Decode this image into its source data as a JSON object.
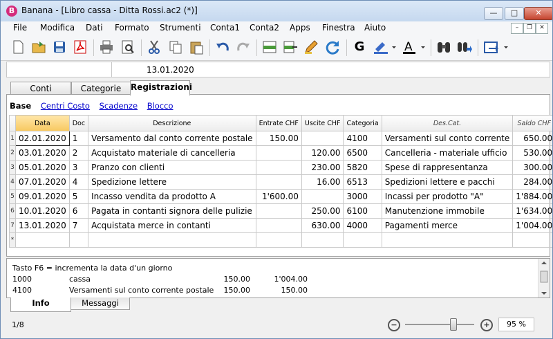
{
  "window": {
    "title": "Banana - [Libro cassa - Ditta Rossi.ac2 (*)]",
    "app_icon": "B"
  },
  "window_buttons": {
    "minimize": "—",
    "maximize": "□",
    "close": "✕"
  },
  "menubar": [
    "File",
    "Modifica",
    "Dati",
    "Formato",
    "Strumenti",
    "Conta1",
    "Conta2",
    "Apps",
    "Finestra",
    "Aiuto"
  ],
  "mdi_buttons": {
    "minimize": "–",
    "restore": "❐",
    "close": "✕"
  },
  "address_bar": {
    "cell_value": "13.01.2020"
  },
  "tabs": [
    "Conti",
    "Categorie",
    "Registrazioni"
  ],
  "active_tab": "Registrazioni",
  "views": {
    "active": "Base",
    "links": [
      "Centri Costo",
      "Scadenze",
      "Blocco"
    ]
  },
  "table": {
    "columns": [
      "Data",
      "Doc",
      "Descrizione",
      "Entrate CHF",
      "Uscite CHF",
      "Categoria",
      "Des.Cat.",
      "Saldo CHF"
    ],
    "rows": [
      {
        "n": "1",
        "date": "02.01.2020",
        "doc": "1",
        "desc": "Versamento dal conto corrente postale",
        "in": "150.00",
        "out": "",
        "cat": "4100",
        "descat": "Versamenti sul conto corrente",
        "saldo": "650.00"
      },
      {
        "n": "2",
        "date": "03.01.2020",
        "doc": "2",
        "desc": "Acquistato materiale di cancelleria",
        "in": "",
        "out": "120.00",
        "cat": "6500",
        "descat": "Cancelleria - materiale ufficio",
        "saldo": "530.00"
      },
      {
        "n": "3",
        "date": "05.01.2020",
        "doc": "3",
        "desc": "Pranzo con clienti",
        "in": "",
        "out": "230.00",
        "cat": "5820",
        "descat": "Spese di rappresentanza",
        "saldo": "300.00"
      },
      {
        "n": "4",
        "date": "07.01.2020",
        "doc": "4",
        "desc": "Spedizione lettere",
        "in": "",
        "out": "16.00",
        "cat": "6513",
        "descat": "Spedizioni lettere e pacchi",
        "saldo": "284.00"
      },
      {
        "n": "5",
        "date": "09.01.2020",
        "doc": "5",
        "desc": "Incasso vendita da prodotto A",
        "in": "1'600.00",
        "out": "",
        "cat": "3000",
        "descat": "Incassi per prodotto \"A\"",
        "saldo": "1'884.00"
      },
      {
        "n": "6",
        "date": "10.01.2020",
        "doc": "6",
        "desc": "Pagata in contanti signora delle pulizie",
        "in": "",
        "out": "250.00",
        "cat": "6100",
        "descat": "Manutenzione immobile",
        "saldo": "1'634.00"
      },
      {
        "n": "7",
        "date": "13.01.2020",
        "doc": "7",
        "desc": "Acquistata merce in contanti",
        "in": "",
        "out": "630.00",
        "cat": "4000",
        "descat": "Pagamenti merce",
        "saldo": "1'004.00"
      }
    ],
    "new_row_marker": "*"
  },
  "info": {
    "hint": "Tasto F6 = incrementa la data d'un giorno",
    "lines": [
      {
        "acct": "1000",
        "desc": "cassa",
        "amount": "150.00",
        "balance": "1'004.00"
      },
      {
        "acct": "4100",
        "desc": "Versamenti sul conto corrente postale",
        "amount": "150.00",
        "balance": "150.00"
      }
    ]
  },
  "bottom_tabs": [
    "Info",
    "Messaggi"
  ],
  "status": {
    "position": "1/8",
    "zoom": "95 %",
    "zoom_level_percent": 95
  },
  "icons": [
    "new-file-icon",
    "open-folder-icon",
    "save-icon",
    "pdf-icon",
    "print-icon",
    "print-preview-icon",
    "cut-icon",
    "copy-icon",
    "paste-icon",
    "undo-icon",
    "redo-icon",
    "insert-row-icon",
    "delete-row-icon",
    "edit-icon",
    "recalculate-icon",
    "bold-icon",
    "highlight-icon",
    "font-color-icon",
    "find-icon",
    "find-next-icon",
    "export-icon"
  ]
}
